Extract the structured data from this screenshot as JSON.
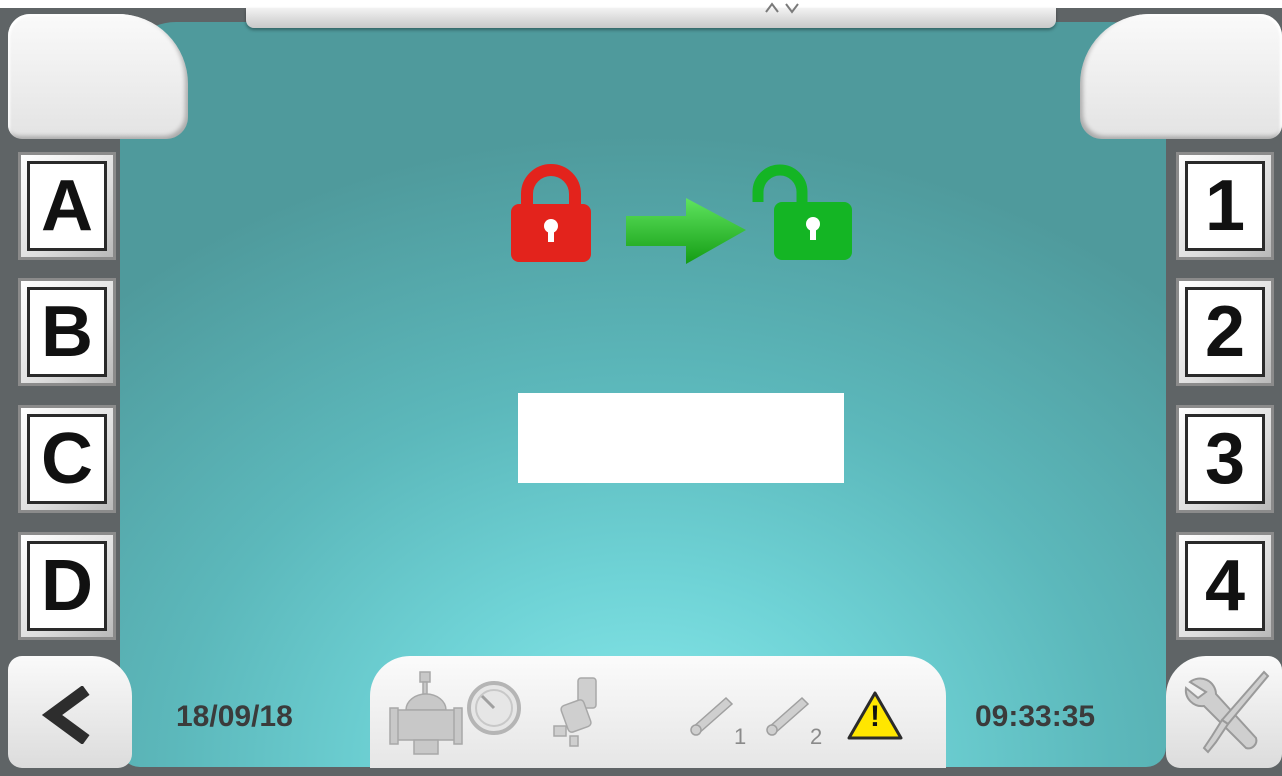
{
  "left_buttons": [
    {
      "label": "A"
    },
    {
      "label": "B"
    },
    {
      "label": "C"
    },
    {
      "label": "D"
    }
  ],
  "right_buttons": [
    {
      "label": "1"
    },
    {
      "label": "2"
    },
    {
      "label": "3"
    },
    {
      "label": "4"
    }
  ],
  "center": {
    "from_icon": "locked-padlock-icon",
    "arrow_icon": "arrow-right-icon",
    "to_icon": "unlocked-padlock-icon",
    "password_value": ""
  },
  "status": {
    "date": "18/09/18",
    "time": "09:33:35",
    "icons": [
      "valve-icon",
      "gauge-icon",
      "solenoid-icon",
      "sensor-1-icon",
      "sensor-2-icon",
      "warning-icon"
    ],
    "sensor_1_label": "1",
    "sensor_2_label": "2",
    "warning_symbol": "!"
  },
  "nav": {
    "back_icon": "chevron-left-icon",
    "tools_icon": "tools-icon"
  },
  "colors": {
    "locked": "#e3231c",
    "unlocked": "#14b524",
    "arrow": "#1fbf1f",
    "warning": "#ffe600"
  }
}
